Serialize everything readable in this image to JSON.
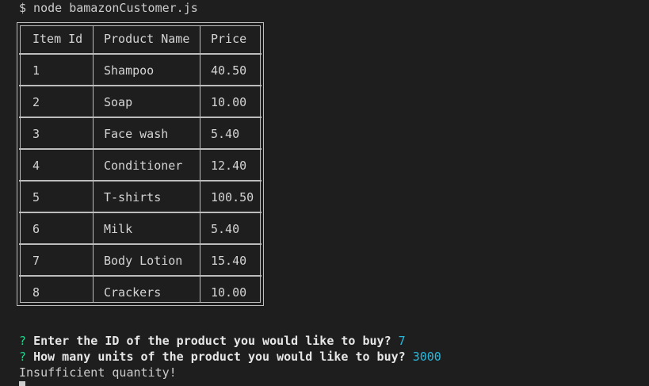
{
  "terminal": {
    "command": "$ node bamazonCustomer.js",
    "table": {
      "headers": [
        "Item Id",
        "Product Name",
        "Price"
      ],
      "rows": [
        [
          "1",
          "Shampoo",
          "40.50"
        ],
        [
          "2",
          "Soap",
          "10.00"
        ],
        [
          "3",
          "Face wash",
          "5.40"
        ],
        [
          "4",
          "Conditioner",
          "12.40"
        ],
        [
          "5",
          "T-shirts",
          "100.50"
        ],
        [
          "6",
          "Milk",
          "5.40"
        ],
        [
          "7",
          "Body Lotion",
          "15.40"
        ],
        [
          "8",
          "Crackers",
          "10.00"
        ]
      ]
    },
    "prompts": [
      {
        "mark": "?",
        "question": "Enter the ID of the product you would like to buy?",
        "answer": "7"
      },
      {
        "mark": "?",
        "question": "How many units of the product you would like to buy?",
        "answer": "3000"
      }
    ],
    "message": "Insufficient quantity!"
  },
  "colors": {
    "background": "#1e1e1e",
    "text": "#cccccc",
    "prompt_mark": "#23d18b",
    "answer": "#29b8db"
  }
}
